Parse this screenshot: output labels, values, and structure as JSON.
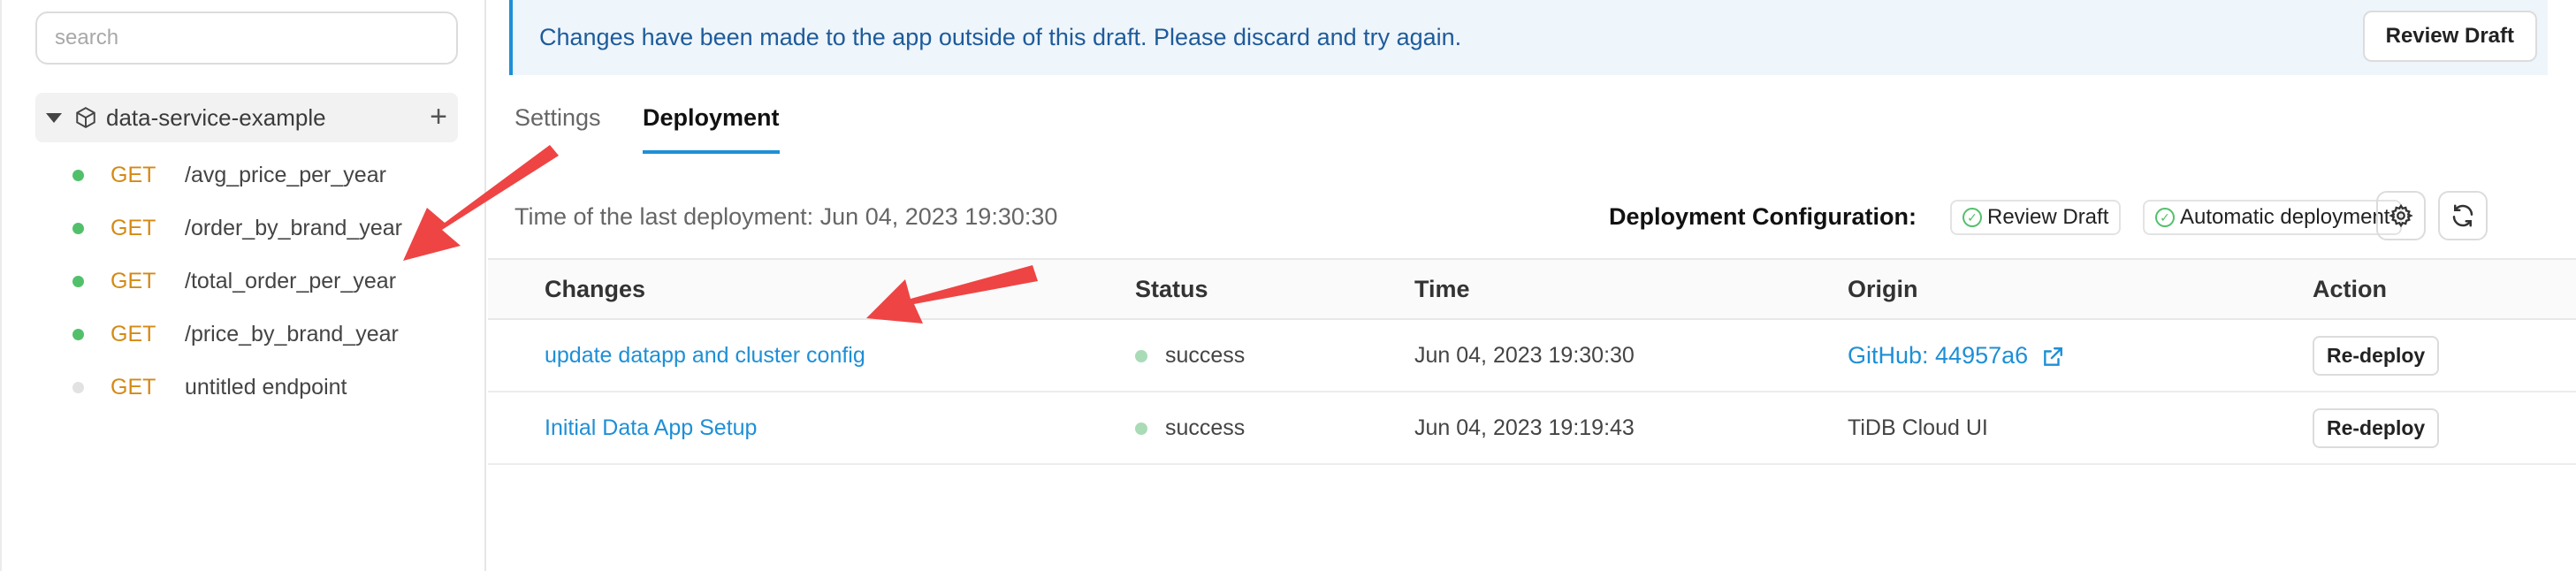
{
  "sidebar": {
    "search_placeholder": "search",
    "project_name": "data-service-example",
    "add_label": "+",
    "endpoints": [
      {
        "method": "GET",
        "path": "/avg_price_per_year",
        "active": true
      },
      {
        "method": "GET",
        "path": "/order_by_brand_year",
        "active": true
      },
      {
        "method": "GET",
        "path": "/total_order_per_year",
        "active": true
      },
      {
        "method": "GET",
        "path": "/price_by_brand_year",
        "active": true
      },
      {
        "method": "GET",
        "path": "untitled endpoint",
        "active": false
      }
    ]
  },
  "banner": {
    "message": "Changes have been made to the app outside of this draft. Please discard and try again.",
    "button_label": "Review Draft"
  },
  "tabs": [
    {
      "label": "Settings",
      "active": false
    },
    {
      "label": "Deployment",
      "active": true
    }
  ],
  "deployment": {
    "last_deployment": "Time of the last deployment: Jun 04, 2023 19:30:30",
    "config_label": "Deployment Configuration:",
    "chips": [
      "Review Draft",
      "Automatic deployment"
    ],
    "icons": [
      "gear-icon",
      "refresh-icon"
    ]
  },
  "table": {
    "headers": [
      "Changes",
      "Status",
      "Time",
      "Origin",
      "Action"
    ],
    "rows": [
      {
        "change": "update datapp and cluster config",
        "status": "success",
        "time": "Jun 04, 2023 19:30:30",
        "origin": "GitHub: 44957a6",
        "origin_link": true,
        "action": "Re-deploy"
      },
      {
        "change": "Initial Data App Setup",
        "status": "success",
        "time": "Jun 04, 2023 19:19:43",
        "origin": "TiDB Cloud UI",
        "origin_link": false,
        "action": "Re-deploy"
      }
    ]
  },
  "colors": {
    "accent": "#1e8fd6",
    "method": "#d48a14",
    "status_green": "#52c06b",
    "arrow_red": "#ef4444"
  }
}
